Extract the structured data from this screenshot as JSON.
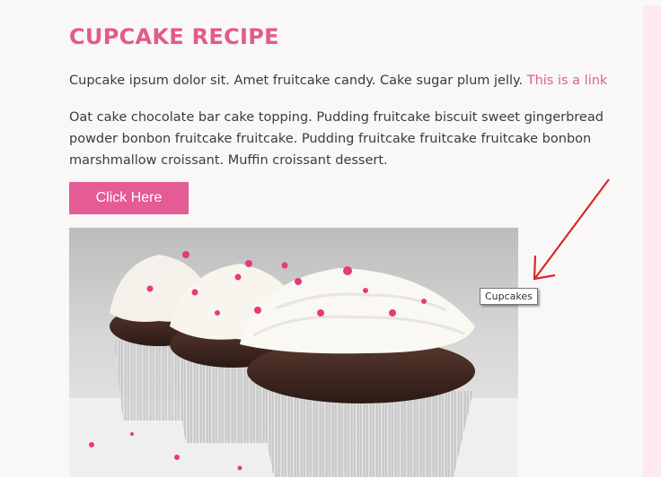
{
  "page": {
    "title": "CUPCAKE RECIPE",
    "paragraph1_text": "Cupcake ipsum dolor sit. Amet fruitcake candy. Cake sugar plum jelly.",
    "paragraph1_link": "This is a link",
    "paragraph2": "Oat cake chocolate bar cake topping. Pudding fruitcake biscuit sweet gingerbread powder bonbon fruitcake fruitcake. Pudding fruitcake fruitcake fruitcake bonbon marshmallow croissant. Muffin croissant dessert.",
    "button_label": "Click Here",
    "image_tooltip": "Cupcakes"
  },
  "colors": {
    "accent": "#e35a8f",
    "button": "#e55b93",
    "annotation_arrow": "#d42a2a",
    "side_panel": "#fde9ee"
  }
}
